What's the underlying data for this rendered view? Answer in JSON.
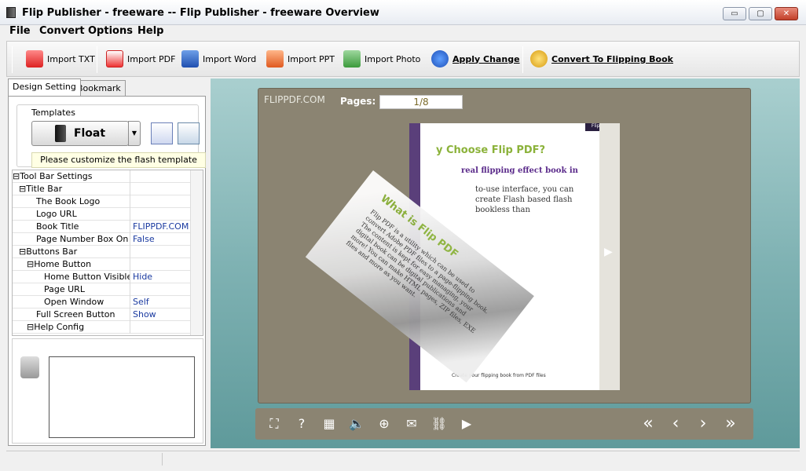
{
  "window": {
    "title": "Flip Publisher - freeware  -- Flip Publisher - freeware Overview",
    "min": "▭",
    "max": "▢",
    "close": "✕"
  },
  "menu": [
    "File",
    "Convert",
    "Options",
    "Help"
  ],
  "toolbar": {
    "import_txt": "Import TXT",
    "import_pdf": "Import PDF",
    "import_word": "Import Word",
    "import_ppt": "Import PPT",
    "import_photo": "Import Photo",
    "apply_change": "Apply Change",
    "convert": "Convert To Flipping Book"
  },
  "tabs": {
    "design": "Design Setting",
    "bookmark": "Bookmark"
  },
  "templates": {
    "group": "Templates",
    "selected": "Float",
    "hint": "Please customize the flash template here"
  },
  "settings": [
    {
      "key": "⊟Tool Bar Settings",
      "value": ""
    },
    {
      "key": "⊟Title Bar",
      "value": ""
    },
    {
      "key": "The Book Logo",
      "value": ""
    },
    {
      "key": "Logo URL",
      "value": ""
    },
    {
      "key": "Book Title",
      "value": "FLIPPDF.COM"
    },
    {
      "key": "Page Number Box On ...",
      "value": "False"
    },
    {
      "key": "⊟Buttons Bar",
      "value": ""
    },
    {
      "key": "⊟Home Button",
      "value": ""
    },
    {
      "key": "Home Button Visible",
      "value": "Hide"
    },
    {
      "key": "Page URL",
      "value": ""
    },
    {
      "key": "Open Window",
      "value": "Self"
    },
    {
      "key": "Full Screen Button",
      "value": "Show"
    },
    {
      "key": "⊟Help Config",
      "value": ""
    }
  ],
  "viewer": {
    "brand": "FLIPPDF.COM",
    "pages_label": "Pages:",
    "pages_value": "1/8",
    "page_heading": "y Choose Flip PDF?",
    "page_sub": "real flipping effect book in",
    "page_body": "to-use interface, you can create Flash based flash bookless than",
    "page_foot": "Create your flipping book from PDF files",
    "fold_title": "What is Flip PDF",
    "fold_body": "Flip PDF is a utility which can be used to convert Adobe PDF files to a page-flipping book. The content is kept for easy managing, your digital book can be digital publications and more! You can make HTML pages, ZIP files, EXE files and more as you want.",
    "tag": "Flip PDF",
    "next_arrow": "▶"
  },
  "controls": {
    "fit": "⛶",
    "help": "?",
    "thumbs": "▦",
    "sound": "🔈",
    "zoom": "⊕",
    "email": "✉",
    "share": "⛓",
    "play": "▶",
    "first": "«",
    "prev": "‹",
    "next": "›",
    "last": "»"
  }
}
